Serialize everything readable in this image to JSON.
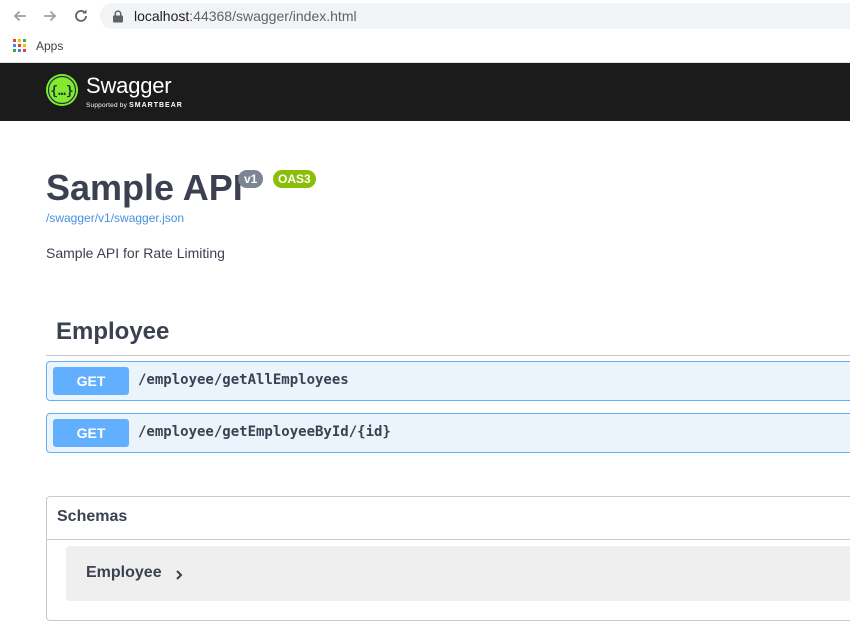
{
  "browser": {
    "url_host": "localhost",
    "url_path": ":44368/swagger/index.html",
    "bookmarks": [
      {
        "label": "Apps",
        "icon": "apps-grid-icon"
      }
    ]
  },
  "topbar": {
    "logo_text": "Swagger",
    "logo_sub_prefix": "Supported by",
    "logo_sub_brand": "SMARTBEAR",
    "bg_color": "#1b1b1b",
    "logo_color": "#85ea2d"
  },
  "info": {
    "title": "Sample API",
    "version": "v1",
    "oas": "OAS3",
    "spec_link": "/swagger/v1/swagger.json",
    "description": "Sample API for Rate Limiting"
  },
  "tags": [
    {
      "name": "Employee",
      "operations": [
        {
          "method": "GET",
          "path": "/employee/getAllEmployees"
        },
        {
          "method": "GET",
          "path": "/employee/getEmployeeById/{id}"
        }
      ]
    }
  ],
  "schemas": {
    "title": "Schemas",
    "models": [
      {
        "name": "Employee"
      }
    ]
  },
  "colors": {
    "get_method": "#61affe",
    "get_bg": "#ebf3fb",
    "oas_badge": "#89bf04",
    "version_badge": "#7d8492",
    "link": "#4990e2"
  }
}
